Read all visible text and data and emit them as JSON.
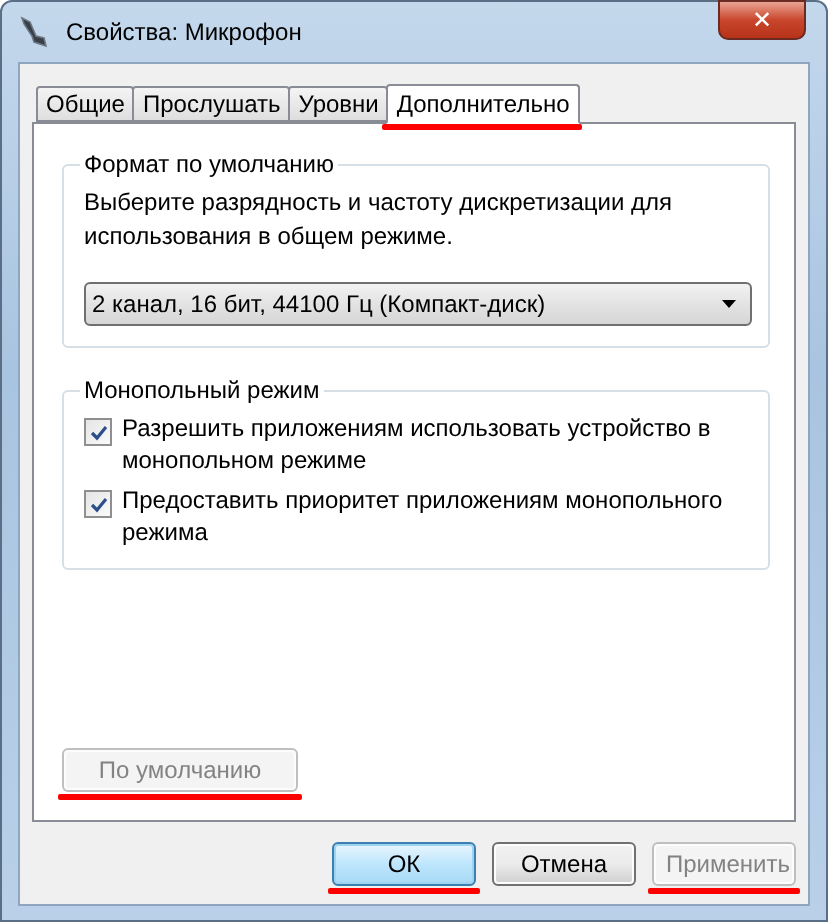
{
  "window": {
    "title": "Свойства: Микрофон",
    "close_button": "✕"
  },
  "tabs": [
    {
      "label": "Общие",
      "selected": false,
      "marked": false
    },
    {
      "label": "Прослушать",
      "selected": false,
      "marked": false
    },
    {
      "label": "Уровни",
      "selected": false,
      "marked": false
    },
    {
      "label": "Дополнительно",
      "selected": true,
      "marked": true
    }
  ],
  "default_format": {
    "title": "Формат по умолчанию",
    "description": "Выберите разрядность и частоту дискретизации для использования в общем режиме.",
    "dropdown": {
      "value": "2 канал, 16 бит, 44100 Гц (Компакт-диск)"
    }
  },
  "exclusive_mode": {
    "title": "Монопольный режим",
    "options": [
      {
        "label": "Разрешить приложениям использовать устройство в монопольном режиме",
        "checked": true
      },
      {
        "label": "Предоставить приоритет приложениям монопольного режима",
        "checked": true
      }
    ]
  },
  "restore_button": {
    "label": "По умолчанию",
    "disabled": true,
    "marked": true
  },
  "buttons": [
    {
      "label": "ОК",
      "default": true,
      "disabled": false,
      "marked": true
    },
    {
      "label": "Отмена",
      "default": false,
      "disabled": false,
      "marked": false
    },
    {
      "label": "Применить",
      "default": false,
      "disabled": true,
      "marked": true
    }
  ]
}
